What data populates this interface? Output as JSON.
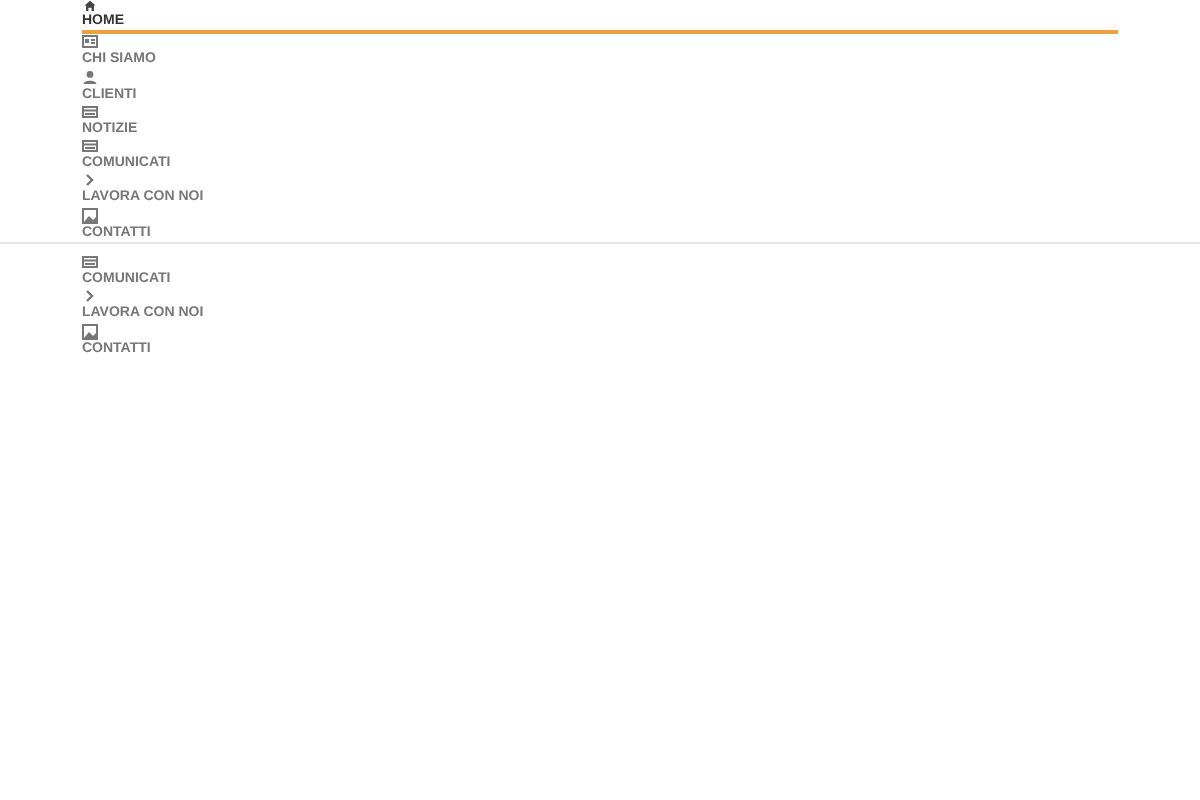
{
  "header_menu": [
    {
      "label": "HOME",
      "selected": true
    },
    {
      "label": "CHI SIAMO",
      "selected": false
    },
    {
      "label": "CLIENTI",
      "selected": false
    },
    {
      "label": "NOTIZIE",
      "selected": false
    },
    {
      "label": "COMUNICATI",
      "selected": false
    },
    {
      "label": "LAVORA CON NOI",
      "selected": false
    },
    {
      "label": "CONTATTI",
      "selected": false
    }
  ],
  "lower_menu": [
    {
      "label": "COMUNICATI",
      "selected": false
    },
    {
      "label": "LAVORA CON NOI",
      "selected": false
    },
    {
      "label": "CONTATTI",
      "selected": false
    }
  ]
}
